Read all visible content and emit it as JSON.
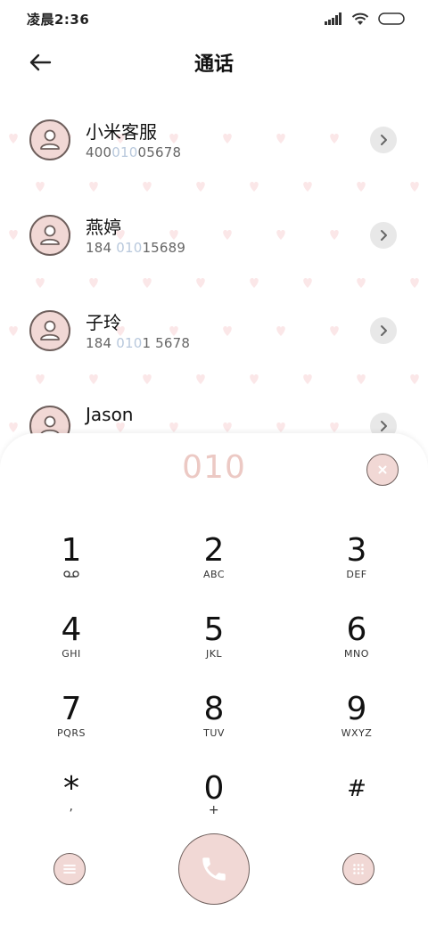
{
  "status_bar": {
    "time": "凌晨2:36",
    "icons": [
      "signal-icon",
      "wifi-icon",
      "battery-icon"
    ]
  },
  "header": {
    "title": "通话",
    "back_icon": "arrow-left-icon"
  },
  "contacts": [
    {
      "name": "小米客服",
      "number_pre": "400",
      "number_hl": "010",
      "number_post": "05678"
    },
    {
      "name": "燕婷",
      "number_pre": "184 ",
      "number_hl": "010",
      "number_post": "15689"
    },
    {
      "name": "子玲",
      "number_pre": "184 ",
      "number_hl": "010",
      "number_post": "1 5678"
    },
    {
      "name": "Jason",
      "number_pre": "",
      "number_hl": "",
      "number_post": ""
    }
  ],
  "dialer": {
    "input_value": "010",
    "keys": [
      {
        "digit": "1",
        "letters": ""
      },
      {
        "digit": "2",
        "letters": "ABC"
      },
      {
        "digit": "3",
        "letters": "DEF"
      },
      {
        "digit": "4",
        "letters": "GHI"
      },
      {
        "digit": "5",
        "letters": "JKL"
      },
      {
        "digit": "6",
        "letters": "MNO"
      },
      {
        "digit": "7",
        "letters": "PQRS"
      },
      {
        "digit": "8",
        "letters": "TUV"
      },
      {
        "digit": "9",
        "letters": "WXYZ"
      },
      {
        "digit": "*",
        "letters": ","
      },
      {
        "digit": "0",
        "letters": "+"
      },
      {
        "digit": "#",
        "letters": ""
      }
    ]
  },
  "colors": {
    "accent_pink": "#f1d8d5",
    "outline_brown": "#6e5f5c",
    "dial_text": "#ecc9c4",
    "highlight_blue": "#b8c8dc"
  }
}
